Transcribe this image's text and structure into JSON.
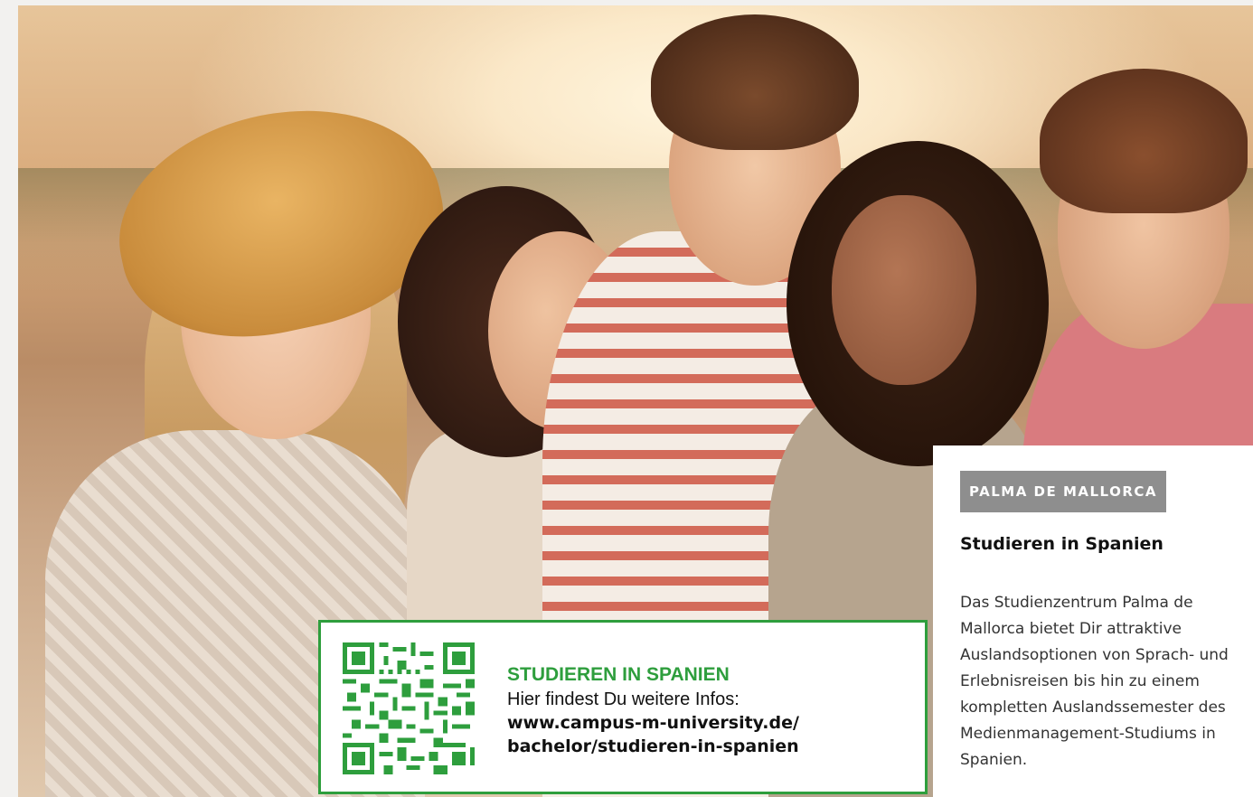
{
  "card": {
    "tag": "PALMA DE MALLORCA",
    "title": "Studieren in Spanien",
    "body": "Das Studienzentrum Palma de Mallorca bietet Dir attraktive Auslandsoptionen von Sprach- und Erlebnisreisen bis hin zu einem kompletten Auslandssemester des Medienmanagement-Studiums in Spanien."
  },
  "qr_box": {
    "heading": "STUDIEREN IN SPANIEN",
    "intro": "Hier findest Du weitere Infos:",
    "link_line1": "www.campus-m-university.de/",
    "link_line2": "bachelor/studieren-in-spanien",
    "qr_icon": "qr-code-icon"
  },
  "colors": {
    "accent_green": "#2e9e3d",
    "tag_gray": "#8e8e8e"
  }
}
